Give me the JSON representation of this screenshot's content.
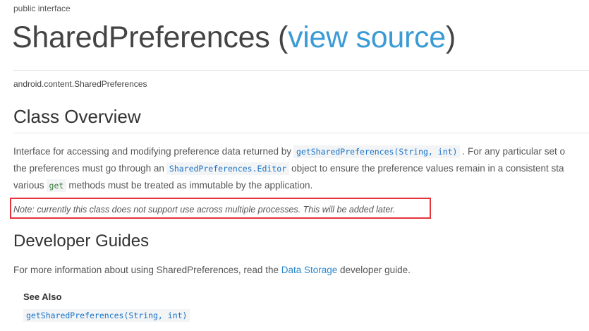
{
  "header": {
    "eyebrow": "public interface",
    "title": "SharedPreferences",
    "title_open": " (",
    "view_source": "view source",
    "title_close": ")",
    "package": "android.content.SharedPreferences"
  },
  "overview": {
    "heading": "Class Overview",
    "line1_a": "Interface for accessing and modifying preference data returned by",
    "line1_code": "getSharedPreferences(String, int)",
    "line1_b": ". For any particular set o",
    "line2_a": "the preferences must go through an",
    "line2_code": "SharedPreferences.Editor",
    "line2_b": "object to ensure the preference values remain in a consistent sta",
    "line3_a": "various",
    "line3_code": "get",
    "line3_b": "methods must be treated as immutable by the application.",
    "note": "Note: currently this class does not support use across multiple processes. This will be added later."
  },
  "guides": {
    "heading": "Developer Guides",
    "text_a": "For more information about using SharedPreferences, read the ",
    "link": "Data Storage",
    "text_b": " developer guide.",
    "see_also_label": "See Also",
    "see_also_link": "getSharedPreferences(String, int)"
  },
  "colors": {
    "link": "#3a9bd5",
    "highlight_border": "#e4343c",
    "code_text": "#1a73c8"
  }
}
